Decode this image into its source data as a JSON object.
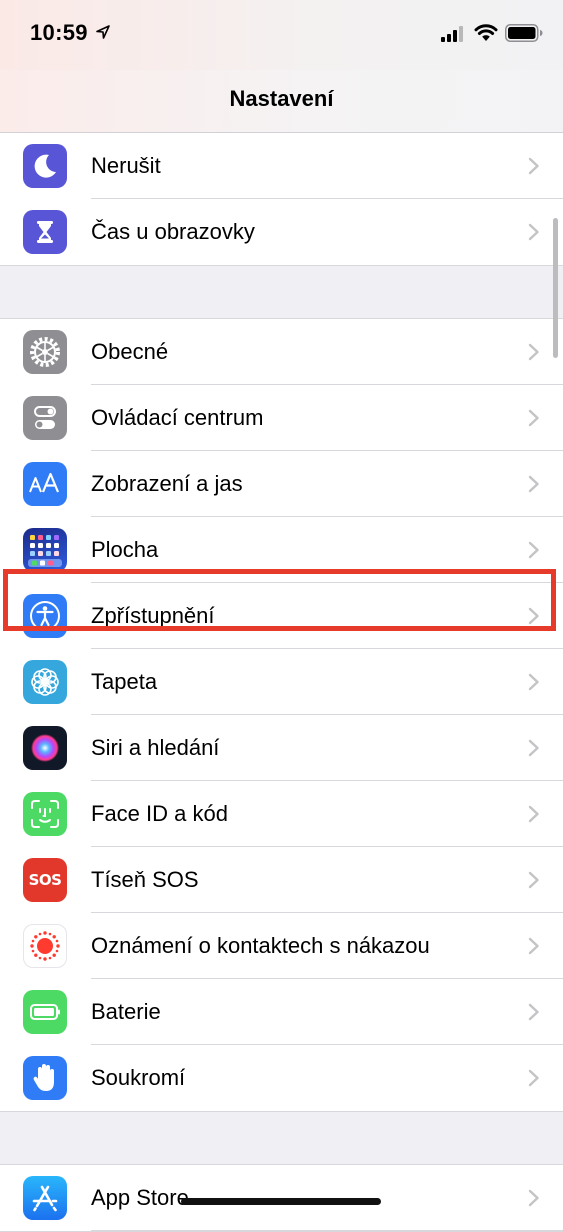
{
  "status_bar": {
    "time": "10:59",
    "icons": [
      "location-arrow-icon",
      "cellular-signal-icon",
      "wifi-icon",
      "battery-icon"
    ]
  },
  "nav": {
    "title": "Nastavení"
  },
  "groups": [
    {
      "items": [
        {
          "label": "Nerušit",
          "icon": "moon-icon",
          "color": "#5856d6"
        },
        {
          "label": "Čas u obrazovky",
          "icon": "hourglass-icon",
          "color": "#5856d6"
        }
      ]
    },
    {
      "items": [
        {
          "label": "Obecné",
          "icon": "gear-icon",
          "color": "#8e8e93"
        },
        {
          "label": "Ovládací centrum",
          "icon": "toggles-icon",
          "color": "#8e8e93"
        },
        {
          "label": "Zobrazení a jas",
          "icon": "text-size-icon",
          "color": "#2f7cf6"
        },
        {
          "label": "Plocha",
          "icon": "home-screen-grid-icon",
          "color": "#2c3fcf"
        },
        {
          "label": "Zpřístupnění",
          "icon": "accessibility-icon",
          "color": "#2f7cf6"
        },
        {
          "label": "Tapeta",
          "icon": "flower-icon",
          "color": "#35a7dd"
        },
        {
          "label": "Siri a hledání",
          "icon": "siri-icon",
          "color": "#1b1b2f"
        },
        {
          "label": "Face ID a kód",
          "icon": "face-id-icon",
          "color": "#4cd964"
        },
        {
          "label": "Tíseň SOS",
          "icon": "sos-icon",
          "icon_text": "SOS",
          "color": "#e2372b"
        },
        {
          "label": "Oznámení o kontaktech s nákazou",
          "icon": "exposure-notification-icon",
          "color": "#ff3b30"
        },
        {
          "label": "Baterie",
          "icon": "battery-setting-icon",
          "color": "#4cd964"
        },
        {
          "label": "Soukromí",
          "icon": "hand-icon",
          "color": "#2f7cf6"
        }
      ]
    },
    {
      "items": [
        {
          "label": "App Store",
          "icon": "app-store-icon",
          "color": "#2f8ef6"
        }
      ]
    }
  ],
  "highlight": {
    "item": "Zpřístupnění",
    "color": "#e63b2a"
  }
}
